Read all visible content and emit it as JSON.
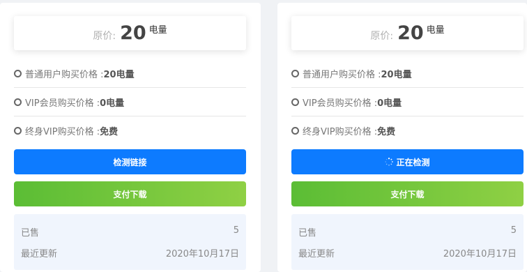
{
  "cards": [
    {
      "price_label": "原价:",
      "price_value": "20",
      "price_unit": "电量",
      "rows": [
        {
          "label": "普通用户购买价格 : ",
          "value": "20电量"
        },
        {
          "label": "VIP会员购买价格 : ",
          "value": "0电量"
        },
        {
          "label": "终身VIP购买价格 : ",
          "value": "免费"
        }
      ],
      "check_button": "检测链接",
      "pay_button": "支付下载",
      "sold_label": "已售",
      "sold_value": "5",
      "updated_label": "最近更新",
      "updated_value": "2020年10月17日"
    },
    {
      "price_label": "原价:",
      "price_value": "20",
      "price_unit": "电量",
      "rows": [
        {
          "label": "普通用户购买价格 : ",
          "value": "20电量"
        },
        {
          "label": "VIP会员购买价格 : ",
          "value": "0电量"
        },
        {
          "label": "终身VIP购买价格 : ",
          "value": "免费"
        }
      ],
      "check_button": "正在检测",
      "pay_button": "支付下载",
      "sold_label": "已售",
      "sold_value": "5",
      "updated_label": "最近更新",
      "updated_value": "2020年10月17日"
    }
  ],
  "colors": {
    "check_button": "#0d7bff",
    "pay_button_start": "#5bbd35",
    "pay_button_end": "#8fd044",
    "stats_background": "#f0f5fd"
  },
  "icons": {
    "row_bullet": "circle-icon",
    "loading": "spinner-icon"
  }
}
